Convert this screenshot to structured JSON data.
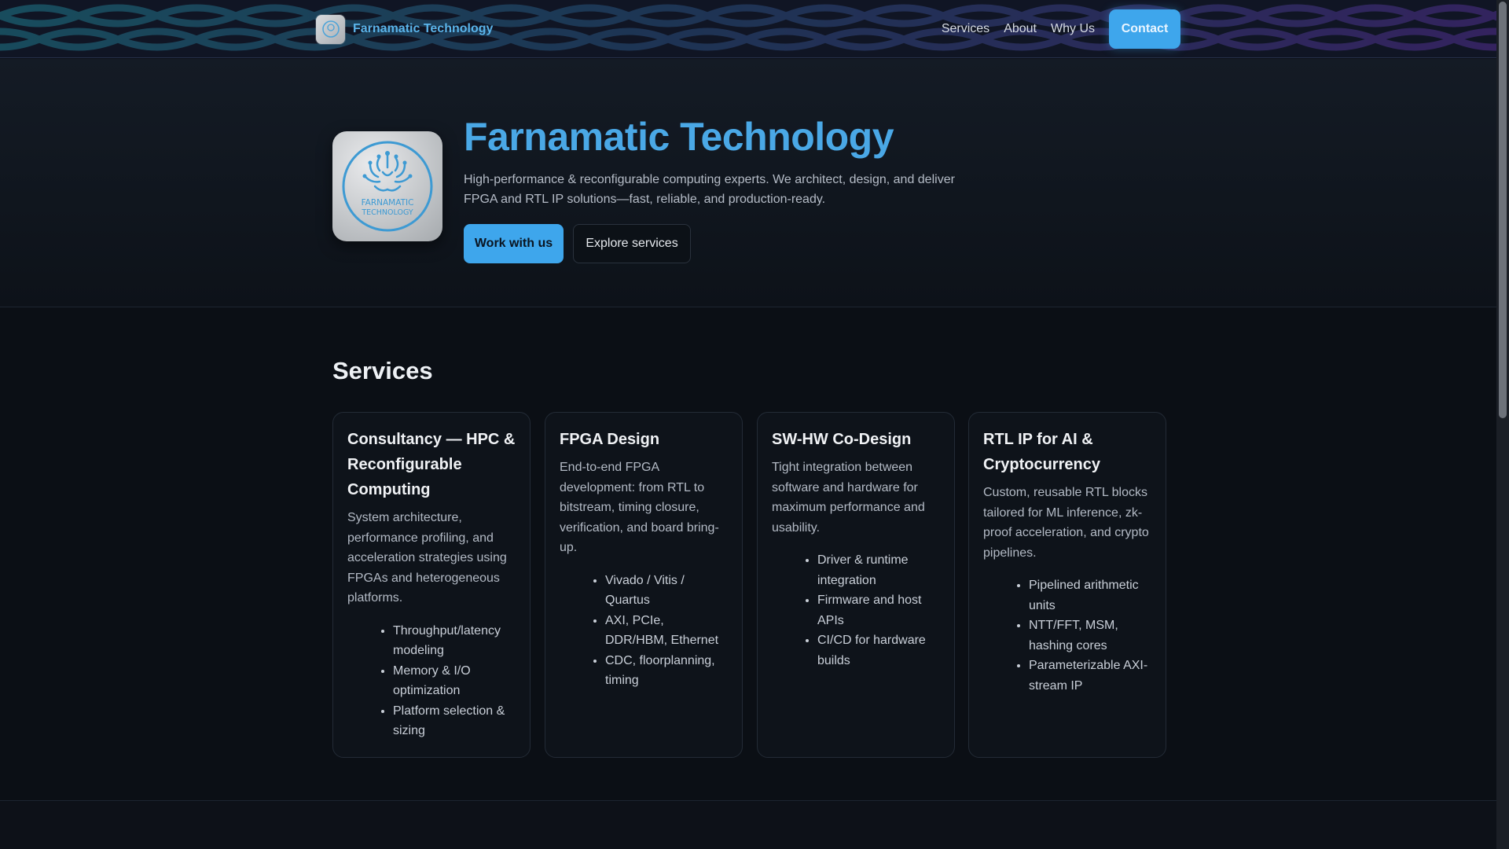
{
  "nav": {
    "brand": "Farnamatic Technology",
    "links": [
      "Services",
      "About",
      "Why Us"
    ],
    "contact": "Contact"
  },
  "hero": {
    "title": "Farnamatic Technology",
    "subtitle": "High-performance & reconfigurable computing experts. We architect, design, and deliver FPGA and RTL IP solutions—fast, reliable, and production-ready.",
    "primary_button": "Work with us",
    "secondary_button": "Explore services",
    "logo_text_line1": "FARNAMATIC",
    "logo_text_line2": "TECHNOLOGY"
  },
  "services": {
    "title": "Services",
    "cards": [
      {
        "title": "Consultancy — HPC & Reconfigurable Computing",
        "description": "System architecture, performance profiling, and acceleration strategies using FPGAs and heterogeneous platforms.",
        "items": [
          "Throughput/latency modeling",
          "Memory & I/O optimization",
          "Platform selection & sizing"
        ]
      },
      {
        "title": "FPGA Design",
        "description": "End-to-end FPGA development: from RTL to bitstream, timing closure, verification, and board bring-up.",
        "items": [
          "Vivado / Vitis / Quartus",
          "AXI, PCIe, DDR/HBM, Ethernet",
          "CDC, floorplanning, timing"
        ]
      },
      {
        "title": "SW-HW Co-Design",
        "description": "Tight integration between software and hardware for maximum performance and usability.",
        "items": [
          "Driver & runtime integration",
          "Firmware and host APIs",
          "CI/CD for hardware builds"
        ]
      },
      {
        "title": "RTL IP for AI & Cryptocurrency",
        "description": "Custom, reusable RTL blocks tailored for ML inference, zk-proof acceleration, and crypto pipelines.",
        "items": [
          "Pipelined arithmetic units",
          "NTT/FFT, MSM, hashing cores",
          "Parameterizable AXI-stream IP"
        ]
      }
    ]
  },
  "colors": {
    "accent": "#3ea6ec",
    "title_blue": "#4aa8e6",
    "background": "#0b0f15"
  }
}
